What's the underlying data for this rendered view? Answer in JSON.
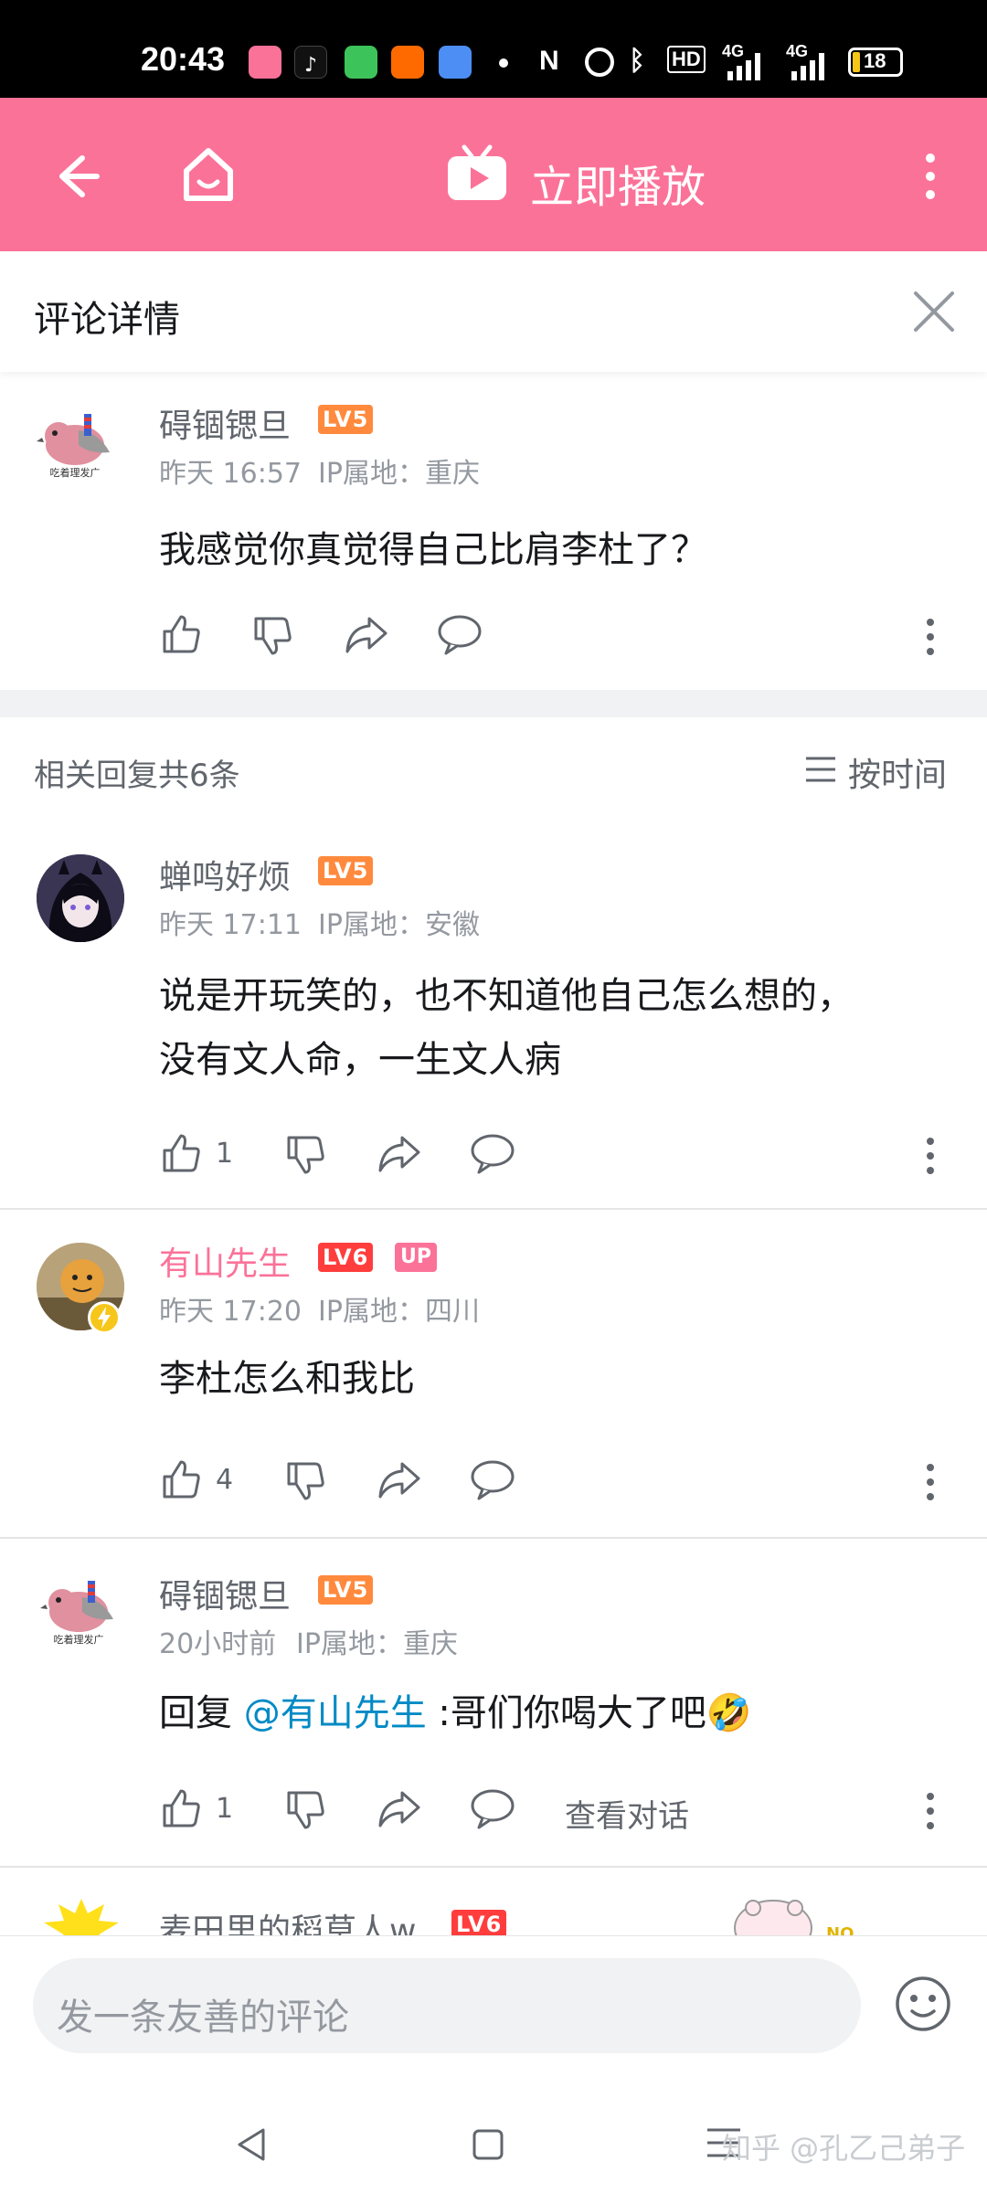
{
  "status_bar": {
    "time": "20:43",
    "battery": "18",
    "network": [
      "4G",
      "4G"
    ],
    "hd": "HD"
  },
  "top_bar": {
    "play_label": "立即播放"
  },
  "detail": {
    "title": "评论详情"
  },
  "main_comment": {
    "username": "碍锢锶旦",
    "level": "LV5",
    "time": "昨天 16:57",
    "ip": "IP属地：重庆",
    "content": "我感觉你真觉得自己比肩李杜了？",
    "avatar_caption": "吃着理发广"
  },
  "replies_header": {
    "count_label": "相关回复共6条",
    "sort_label": "按时间"
  },
  "replies": [
    {
      "username": "蝉鸣好烦",
      "level": "LV5",
      "time": "昨天 17:11",
      "ip": "IP属地：安徽",
      "content_line1": "说是开玩笑的，也不知道他自己怎么想的，",
      "content_line2": "没有文人命，一生文人病",
      "likes": "1"
    },
    {
      "username": "有山先生",
      "level": "LV6",
      "badge": "UP",
      "time": "昨天 17:20",
      "ip": "IP属地：四川",
      "content": "李杜怎么和我比",
      "likes": "4"
    },
    {
      "username": "碍锢锶旦",
      "level": "LV5",
      "time": "20小时前",
      "ip": "IP属地：重庆",
      "content_prefix": "回复 ",
      "mention": "@有山先生",
      "content_suffix": " :哥们你喝大了吧🤣",
      "likes": "1",
      "view_conversation": "查看对话",
      "avatar_caption": "吃着理发广"
    },
    {
      "username": "麦田里的稻草人w",
      "level": "LV6"
    }
  ],
  "input": {
    "placeholder": "发一条友善的评论"
  },
  "watermark": "知乎 @孔乙己弟子",
  "colors": {
    "brand_pink": "#fb7299",
    "lv5": "#ff8a3d",
    "lv6": "#ff3d3d",
    "mention": "#008ac5"
  }
}
